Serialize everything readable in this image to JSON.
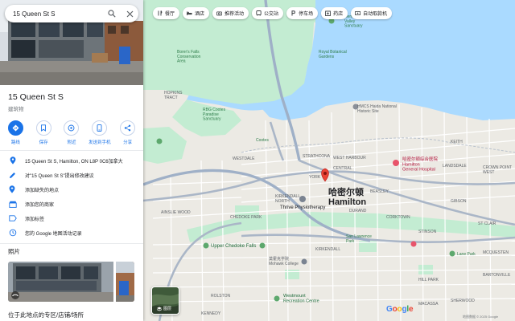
{
  "colors": {
    "accent": "#1a73e8",
    "water": "#aadaff",
    "park": "#c3ecd2",
    "road_major": "#aab6c7",
    "pin": "#ea4335"
  },
  "search": {
    "query": "15 Queen St S"
  },
  "place": {
    "title": "15 Queen St S",
    "category": "建筑物"
  },
  "actions": [
    {
      "label": "路线",
      "icon": "directions-icon"
    },
    {
      "label": "保存",
      "icon": "bookmark-icon"
    },
    {
      "label": "附近",
      "icon": "nearby-icon"
    },
    {
      "label": "发送到手机",
      "icon": "send-to-phone-icon"
    },
    {
      "label": "分享",
      "icon": "share-icon"
    }
  ],
  "info_rows": [
    {
      "icon": "location-pin-icon",
      "text": "15 Queen St S, Hamilton, ON L8P 0C6加拿大"
    },
    {
      "icon": "edit-pencil-icon",
      "text": "对\"15 Queen St S\"提出修改建议"
    },
    {
      "icon": "add-place-icon",
      "text": "添加缺失的地点"
    },
    {
      "icon": "add-business-icon",
      "text": "添加您的商家"
    },
    {
      "icon": "label-icon",
      "text": "添加标签"
    },
    {
      "icon": "history-icon",
      "text": "您的 Google 地图活动记录"
    }
  ],
  "photos_heading": "照片",
  "more_heading": "位于此地点的专区/店铺/场所",
  "chips": [
    {
      "label": "餐厅",
      "icon": "restaurant-icon"
    },
    {
      "label": "酒店",
      "icon": "hotel-icon"
    },
    {
      "label": "推荐活动",
      "icon": "camera-icon"
    },
    {
      "label": "公交站",
      "icon": "transit-icon"
    },
    {
      "label": "停车场",
      "icon": "parking-icon"
    },
    {
      "label": "药店",
      "icon": "pharmacy-icon"
    },
    {
      "label": "自动取款机",
      "icon": "atm-icon"
    }
  ],
  "layers_label": "图层",
  "map_labels": {
    "hamilton_cn": "哈密尔顿",
    "hamilton_en": "Hamilton",
    "hopkins": "HOPKINS\nTRACT",
    "borers": "Borer's Falls\nConservation\nArea",
    "royal_botanical": "Royal Botanical\nGardens",
    "hendrie": "Hendrie\nValley\nSanctuary",
    "rbg": "RBG Cootes\nParadise\nSanctuary",
    "westdale": "WESTDALE",
    "strathcona": "STRATHCONA",
    "west_harbour": "WEST HARBOUR",
    "central": "CENTRAL",
    "kirkendall": "KIRKENDALL\nNORTH",
    "durand": "DURAND",
    "corktown": "CORKTOWN",
    "ainslie": "AINSLIE WOOD",
    "chedoke": "CHEDOKE PARK",
    "thrive": "Thrive Physiotherapy",
    "upper_chedoke": "Upper Chedoke Falls",
    "mohawk": "莫霍克学院\nMohawk College",
    "westmount": "Westmount\nRecreation Centre",
    "st_lawrence": "San Lawrence\nPark",
    "hamilton_general": "哈密尔顿综合医院\nHamilton\nGeneral Hospital",
    "hmcs": "HMCS Haida National\nHistoric Site",
    "lane": "Lane Park",
    "cootes": "Cootes",
    "kirkendall_s": "KIRKENDALL",
    "stinson": "STINSON",
    "landsdale": "LANDSDALE",
    "gibson": "GIBSON",
    "crown_point": "CROWN POINT\nWEST",
    "st_clair": "ST CLAIR",
    "mcquesten": "MCQUESTEN",
    "bartonville": "BARTONVILLE",
    "sherwood": "SHERWOOD",
    "macassa": "MACASSA",
    "rolston": "ROLSTON",
    "kennedy": "KENNEDY",
    "hilltop": "HILL PARK",
    "keith": "KEITH",
    "york": "YORK",
    "beasley": "BEASLEY"
  },
  "attribution": "地图数据 © 2025 Google"
}
